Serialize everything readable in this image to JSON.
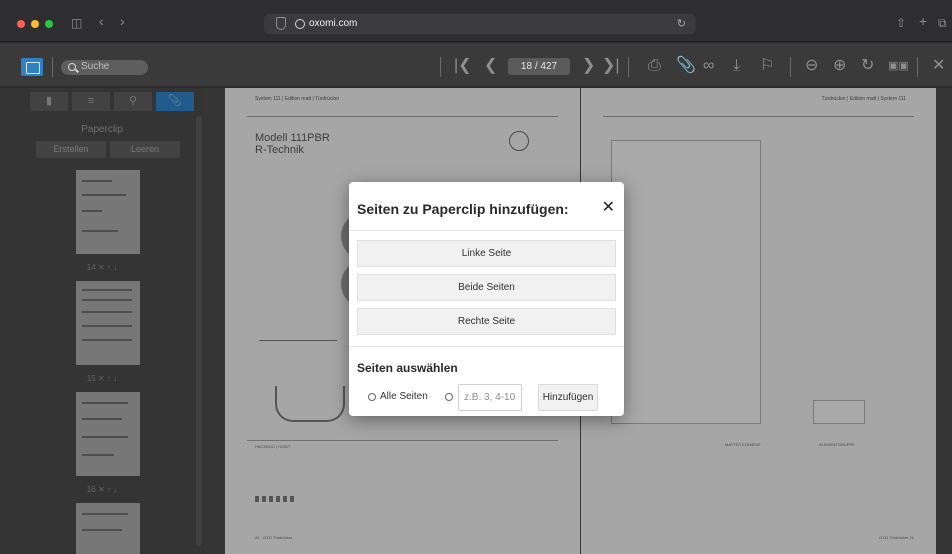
{
  "browser": {
    "url": "oxomi.com",
    "icons": [
      "sidebar-icon",
      "back-icon",
      "forward-icon",
      "shield-icon",
      "globe-icon",
      "reload-icon",
      "share-icon",
      "new-tab-icon",
      "tabs-overview-icon"
    ]
  },
  "toolbar": {
    "search_placeholder": "Suche",
    "page_indicator": "18 / 427"
  },
  "sidebar": {
    "title": "Paperclip",
    "create_label": "Erstellen",
    "clear_label": "Leeren",
    "thumbs": [
      {
        "caption": "14 ✕ ↑ ↓"
      },
      {
        "caption": "15 ✕ ↑ ↓"
      },
      {
        "caption": "16 ✕ ↑ ↓"
      }
    ]
  },
  "document": {
    "left_header": "System 111 | Edition matt | Türdrücker",
    "right_header": "Türdrücker | Edition matt | System 111",
    "model_title": "Modell 111PBR",
    "model_subtitle": "R-Technik",
    "section_left": "HACEBOU | HOBIT",
    "right_col_a": "MATTES ELEMENT",
    "right_col_b": "ELEMENTGRUPPE",
    "footer_left": "20 · OXO Türdrücker",
    "footer_right": "OXO Türdrücker 21"
  },
  "modal": {
    "title": "Seiten zu Paperclip hinzufügen:",
    "close": "✕",
    "options": [
      "Linke Seite",
      "Beide Seiten",
      "Rechte Seite"
    ],
    "select_title": "Seiten auswählen",
    "all_pages_label": "Alle Seiten",
    "range_placeholder": "z.B. 3, 4-10",
    "add_label": "Hinzufügen"
  },
  "colors": {
    "accent": "#2e7fc4",
    "chrome": "#2e2e30",
    "toolbar": "#3a3a3a",
    "sidebar": "#484848"
  }
}
